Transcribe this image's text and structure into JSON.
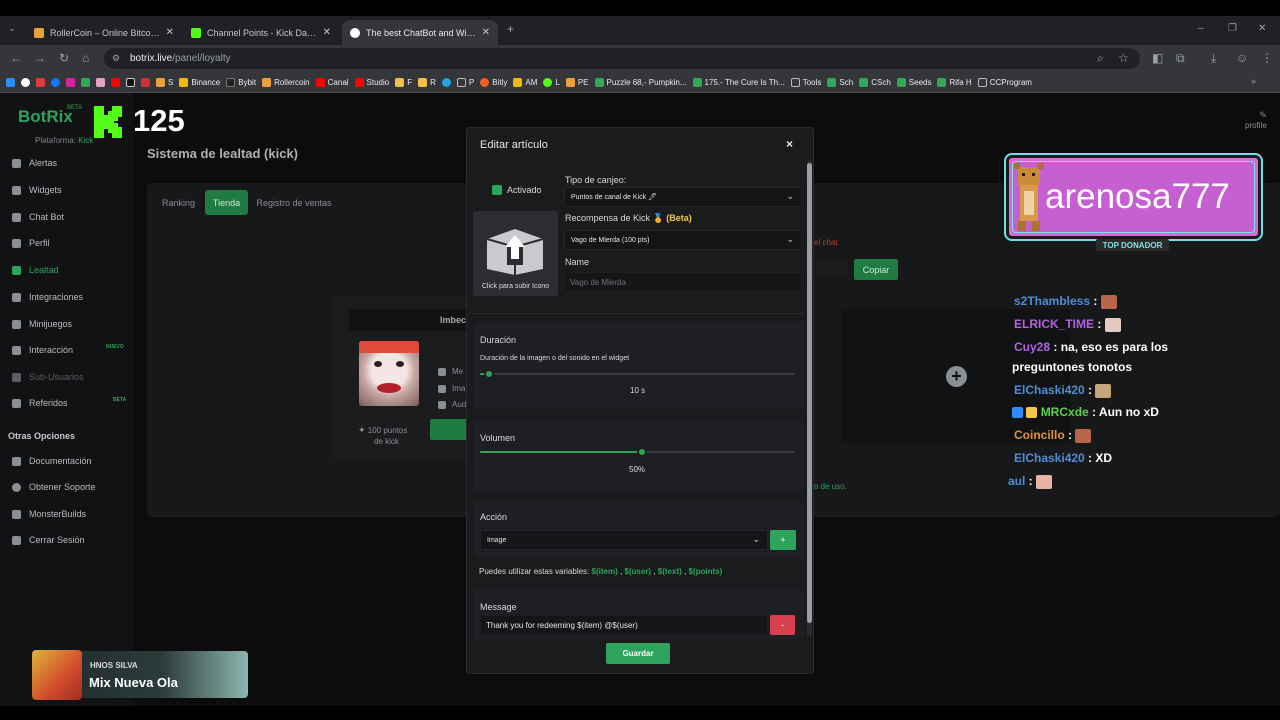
{
  "browser": {
    "tabs": [
      {
        "label": "RollerCoin – Online Bitcoin Min",
        "icon": "rollercoin-icon",
        "color": "#e9a23b"
      },
      {
        "label": "Channel Points - Kick Dashboar",
        "icon": "kick-icon",
        "color": "#53fc18"
      },
      {
        "label": "The best ChatBot and Widgets",
        "icon": "botrix-icon",
        "color": "#ffffff"
      }
    ],
    "url_host": "botrix.live",
    "url_path": "/panel/loyalty",
    "bookmarks": [
      "S",
      "Binance",
      "Bybit",
      "Rollercoin",
      "Canal",
      "Studio",
      "F",
      "R",
      "P",
      "Bitly",
      "AM",
      "L",
      "PE",
      "Puzzle 68,- Pumpkin...",
      "175.- The Cure Is Th...",
      "Tools",
      "Sch",
      "CSch",
      "Seeds",
      "Rifa H",
      "CCProgram"
    ]
  },
  "app": {
    "brand": "BotRix",
    "brand_badge": "BETA",
    "platform_label": "Plataforma:",
    "platform_value": "Kick",
    "viewer_count": "125",
    "profile_label": "profile",
    "page_title": "Sistema de lealtad (kick)"
  },
  "sidebar": {
    "items": [
      {
        "label": "Alertas"
      },
      {
        "label": "Widgets"
      },
      {
        "label": "Chat Bot"
      },
      {
        "label": "Perfil"
      },
      {
        "label": "Lealtad"
      },
      {
        "label": "Integraciones"
      },
      {
        "label": "Minijuegos"
      },
      {
        "label": "Interacción",
        "badge": "NUEVO"
      },
      {
        "label": "Sub-Usuarios"
      },
      {
        "label": "Referidos",
        "badge": "BETA"
      }
    ],
    "section_title": "Otras Opciones",
    "other_items": [
      {
        "label": "Documentación"
      },
      {
        "label": "Obtener Soporte"
      },
      {
        "label": "MonsterBuilds"
      },
      {
        "label": "Cerrar Sesión"
      }
    ]
  },
  "loyalty": {
    "tabs": [
      "Ranking",
      "Tienda",
      "Registro de ventas"
    ],
    "active_tab": "Tienda",
    "item_title": "Imbec",
    "item_rows": [
      "Me",
      "Ima",
      "Aud"
    ],
    "item_points": "100 puntos",
    "item_points_suffix": "de kick",
    "copy_button": "Copiar",
    "red_note": "el chat",
    "green_note": "o de uso."
  },
  "modal": {
    "title": "Editar artículo",
    "close": "×",
    "enabled_label": "Activado",
    "upload_label": "Click para subir Icono",
    "redeem_type_label": "Tipo de canjeo:",
    "redeem_type_value": "Puntos de canal de Kick 🖊",
    "reward_label": "Recompensa de Kick",
    "reward_beta": "🏅 (Beta)",
    "reward_value": "Vago de Mierda (100 pts)",
    "name_label": "Name",
    "name_placeholder": "Vago de Mierda",
    "duration_title": "Duración",
    "duration_help": "Duración de la imagen o del sonido en el widget",
    "duration_value": 0,
    "duration_display": "10 s",
    "volume_title": "Volumen",
    "volume_value": 0.5,
    "volume_display": "50%",
    "action_title": "Acción",
    "action_value": "Image",
    "action_add": "+",
    "vars_prefix": "Puedes utilizar estas variables:",
    "vars": [
      "$(item)",
      "$(user)",
      "$(text)",
      "$(points)"
    ],
    "message_title": "Message",
    "message_value": "Thank you for redeeming $(item) @$(user)",
    "message_remove": "-",
    "save_button": "Guardar"
  },
  "overlay": {
    "top_donor_name": "arenosa777",
    "top_donor_label": "TOP DONADOR",
    "chat": [
      {
        "user": "s2Thambless",
        "color": "#4d8ed6",
        "text": ""
      },
      {
        "user": "ELRICK_TIME",
        "color": "#b263e0",
        "text": ""
      },
      {
        "user": "Cuy28",
        "color": "#b263e0",
        "text": "na, eso es para los"
      },
      {
        "user": "",
        "color": "#ffffff",
        "text": "preguntones tonotos"
      },
      {
        "user": "ElChaski420",
        "color": "#4d8ed6",
        "text": ""
      },
      {
        "user": "MRCxde",
        "color": "#57d24a",
        "text": "Aun no xD"
      },
      {
        "user": "Coincillo",
        "color": "#e0913a",
        "text": ""
      },
      {
        "user": "ElChaski420",
        "color": "#4d8ed6",
        "text": "XD"
      },
      {
        "user": "aul",
        "color": "#4d8ed6",
        "text": ""
      }
    ],
    "now_playing_artist": "HNOS SILVA",
    "now_playing_title": "Mix Nueva Ola"
  }
}
